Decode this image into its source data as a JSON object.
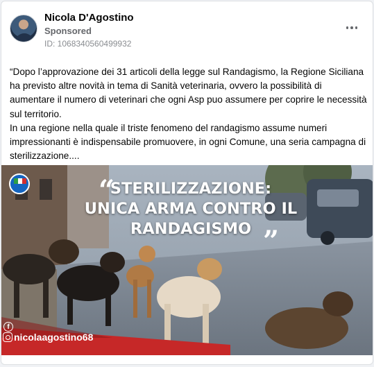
{
  "post": {
    "author": "Nicola D'Agostino",
    "sponsored_label": "Sponsored",
    "ad_id": "ID: 1068340560499932",
    "body": "“Dopo l’approvazione dei 31 articoli della legge sul Randagismo, la Regione Siciliana ha previsto altre novità in tema di Sanità veterinaria, ovvero la possibilità di aumentare il numero di veterinari che ogni Asp puo assumere per coprire le necessità sul territorio.\nIn una regione nella quale il triste fenomeno del randagismo assume numeri impressionanti è indispensabile promuovere, in ogni Comune, una seria campagna di sterilizzazione....",
    "more_icon": "more-horizontal-icon"
  },
  "image": {
    "headline_lines": [
      "STERILIZZAZIONE:",
      "UNICA ARMA CONTRO IL",
      "RANDAGISMO"
    ],
    "quote_open": "“",
    "quote_close": "”",
    "facebook_icon_glyph": "f",
    "instagram_handle": "nicolaagostino68",
    "accent_color": "#c62828",
    "brand_color": "#1565c0"
  }
}
